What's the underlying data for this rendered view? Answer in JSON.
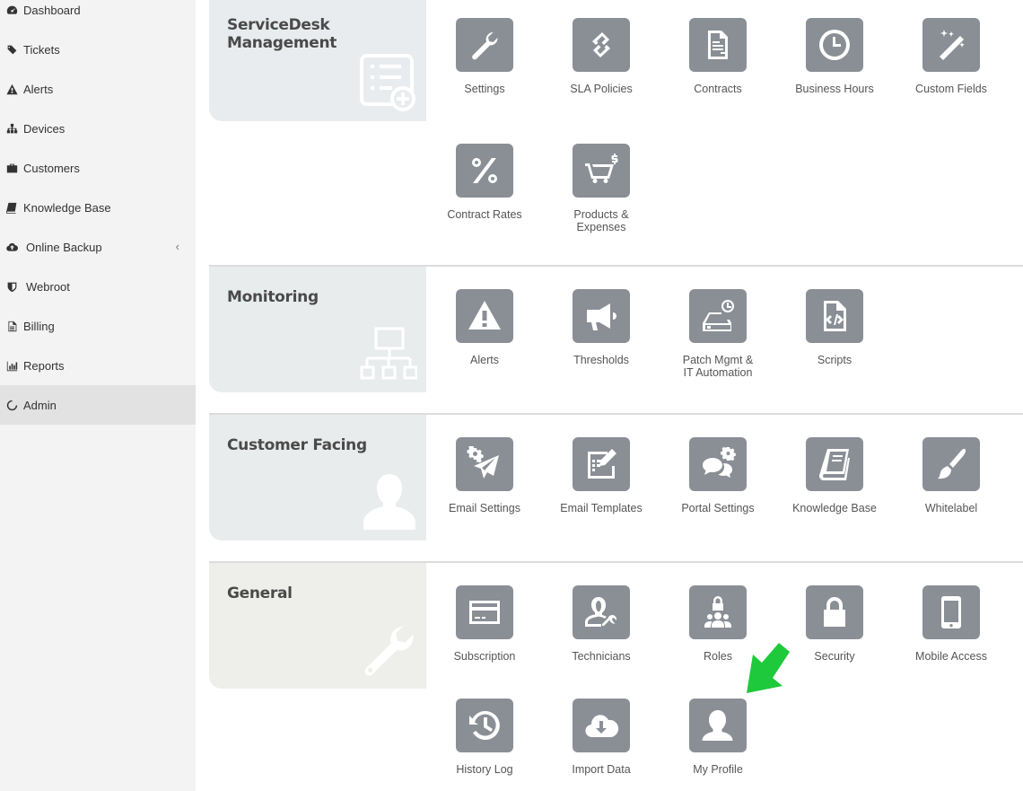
{
  "sidebar": {
    "items": [
      {
        "label": "Dashboard",
        "icon": "dashboard-icon"
      },
      {
        "label": "Tickets",
        "icon": "tags-icon"
      },
      {
        "label": "Alerts",
        "icon": "warning-icon"
      },
      {
        "label": "Devices",
        "icon": "sitemap-icon"
      },
      {
        "label": "Customers",
        "icon": "briefcase-icon"
      },
      {
        "label": "Knowledge Base",
        "icon": "book-icon"
      },
      {
        "label": "Online Backup",
        "icon": "cloud-upload-icon",
        "chevron": "‹"
      },
      {
        "label": "Webroot",
        "icon": "shield-icon"
      },
      {
        "label": "Billing",
        "icon": "file-text-icon"
      },
      {
        "label": "Reports",
        "icon": "bar-chart-icon"
      },
      {
        "label": "Admin",
        "icon": "spinner-icon",
        "active": true
      }
    ]
  },
  "sections": [
    {
      "title": "ServiceDesk Management",
      "icon": "form-add-icon",
      "tiles": [
        {
          "label": "Settings",
          "icon": "wrench-icon"
        },
        {
          "label": "SLA Policies",
          "icon": "link-icon"
        },
        {
          "label": "Contracts",
          "icon": "contract-icon"
        },
        {
          "label": "Business Hours",
          "icon": "clock-icon"
        },
        {
          "label": "Custom Fields",
          "icon": "magic-wand-icon"
        },
        {
          "label": "Contract Rates",
          "icon": "percent-icon"
        },
        {
          "label": "Products & Expenses",
          "icon": "cart-dollar-icon"
        }
      ]
    },
    {
      "title": "Monitoring",
      "icon": "network-icon",
      "tiles": [
        {
          "label": "Alerts",
          "icon": "warning-icon"
        },
        {
          "label": "Thresholds",
          "icon": "megaphone-icon"
        },
        {
          "label": "Patch Mgmt & IT Automation",
          "icon": "drive-clock-icon"
        },
        {
          "label": "Scripts",
          "icon": "code-file-icon"
        }
      ]
    },
    {
      "title": "Customer Facing",
      "icon": "user-silhouette-icon",
      "tiles": [
        {
          "label": "Email Settings",
          "icon": "paper-plane-gear-icon"
        },
        {
          "label": "Email Templates",
          "icon": "edit-form-icon"
        },
        {
          "label": "Portal Settings",
          "icon": "chat-gear-icon"
        },
        {
          "label": "Knowledge Base",
          "icon": "book-icon"
        },
        {
          "label": "Whitelabel",
          "icon": "paint-brush-icon"
        }
      ]
    },
    {
      "title": "General",
      "icon": "wrench-icon",
      "tiles": [
        {
          "label": "Subscription",
          "icon": "credit-card-icon"
        },
        {
          "label": "Technicians",
          "icon": "technician-icon"
        },
        {
          "label": "Roles",
          "icon": "roles-lock-icon"
        },
        {
          "label": "Security",
          "icon": "lock-icon"
        },
        {
          "label": "Mobile Access",
          "icon": "mobile-icon"
        },
        {
          "label": "History Log",
          "icon": "history-icon"
        },
        {
          "label": "Import Data",
          "icon": "cloud-download-icon"
        },
        {
          "label": "My Profile",
          "icon": "user-icon"
        }
      ]
    }
  ],
  "annotation": {
    "arrow_color": "#1ec93b",
    "icon": "green-arrow-icon"
  },
  "colors": {
    "tile_bg": "#8a8f96",
    "panel_bg": "#e9ecee",
    "sidebar_bg": "#f3f3f3"
  }
}
